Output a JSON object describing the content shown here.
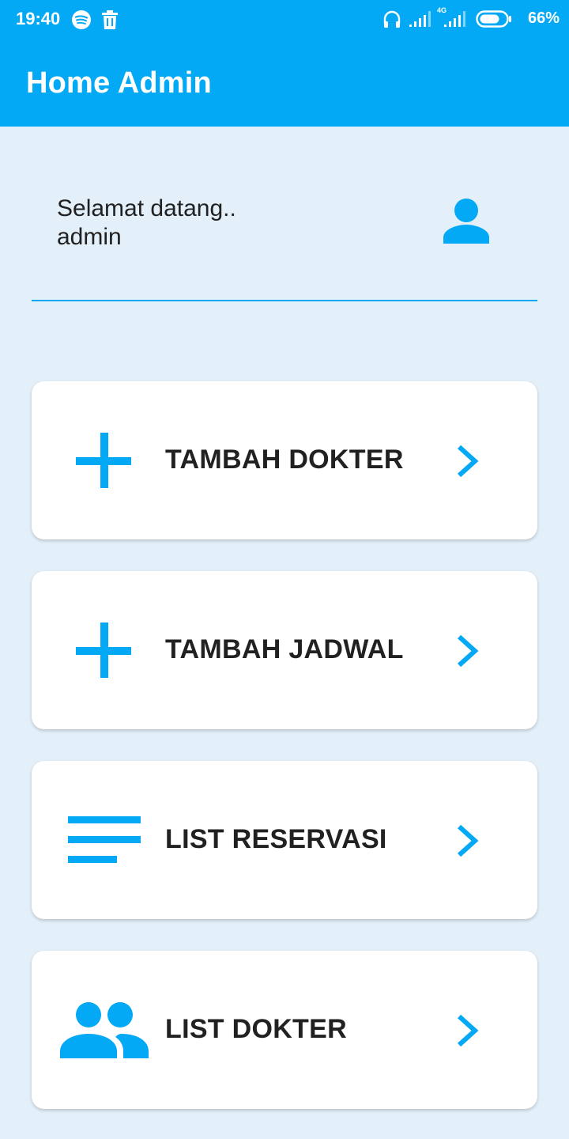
{
  "status_bar": {
    "time": "19:40",
    "battery_percent": "66%",
    "network_label": "4G",
    "left_icons": [
      "spotify-icon",
      "trash-icon"
    ],
    "right_icons": [
      "headphones-icon",
      "signal-icon",
      "signal-4g-icon",
      "battery-icon"
    ]
  },
  "app_bar": {
    "title": "Home Admin",
    "background_color": "#03a9f4"
  },
  "welcome": {
    "line1": "Selamat datang..",
    "line2": "admin",
    "icon": "person-icon"
  },
  "menu": [
    {
      "label": "TAMBAH DOKTER",
      "icon": "plus-icon",
      "chevron": "chevron-right-icon"
    },
    {
      "label": "TAMBAH JADWAL",
      "icon": "plus-icon",
      "chevron": "chevron-right-icon"
    },
    {
      "label": "LIST RESERVASI",
      "icon": "list-icon",
      "chevron": "chevron-right-icon"
    },
    {
      "label": "LIST DOKTER",
      "icon": "people-icon",
      "chevron": "chevron-right-icon"
    }
  ],
  "colors": {
    "accent": "#03a9f4",
    "background": "#e3eff9",
    "card": "#ffffff",
    "text": "#212121"
  }
}
